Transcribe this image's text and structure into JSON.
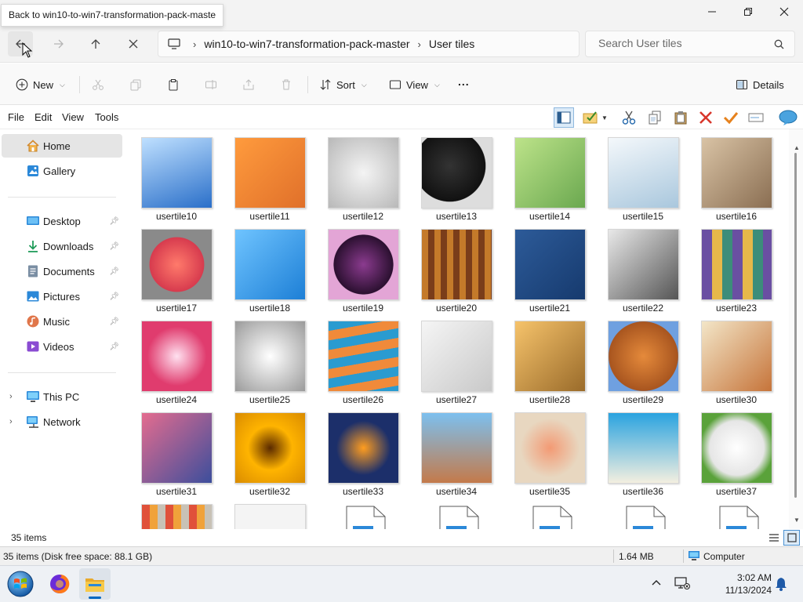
{
  "tooltip": "Back to win10-to-win7-transformation-pack-maste",
  "address": {
    "segments": [
      "win10-to-win7-transformation-pack-master",
      "User tiles"
    ],
    "search_placeholder": "Search User tiles"
  },
  "commands": {
    "new": "New",
    "sort": "Sort",
    "view": "View",
    "more": "...",
    "details": "Details"
  },
  "menu": [
    "File",
    "Edit",
    "View",
    "Tools"
  ],
  "sidebar": {
    "items": [
      {
        "label": "Home",
        "icon": "home-icon",
        "pinned": false,
        "expandable": false,
        "selected": true
      },
      {
        "label": "Gallery",
        "icon": "gallery-icon",
        "pinned": false,
        "expandable": false,
        "selected": false
      },
      {
        "label": "Desktop",
        "icon": "desktop-icon",
        "pinned": true,
        "expandable": false,
        "selected": false
      },
      {
        "label": "Downloads",
        "icon": "downloads-icon",
        "pinned": true,
        "expandable": false,
        "selected": false
      },
      {
        "label": "Documents",
        "icon": "documents-icon",
        "pinned": true,
        "expandable": false,
        "selected": false
      },
      {
        "label": "Pictures",
        "icon": "pictures-icon",
        "pinned": true,
        "expandable": false,
        "selected": false
      },
      {
        "label": "Music",
        "icon": "music-icon",
        "pinned": true,
        "expandable": false,
        "selected": false
      },
      {
        "label": "Videos",
        "icon": "videos-icon",
        "pinned": true,
        "expandable": false,
        "selected": false
      },
      {
        "label": "This PC",
        "icon": "this-pc-icon",
        "pinned": false,
        "expandable": true,
        "selected": false
      },
      {
        "label": "Network",
        "icon": "network-icon",
        "pinned": false,
        "expandable": true,
        "selected": false
      }
    ]
  },
  "files": [
    "usertile10",
    "usertile11",
    "usertile12",
    "usertile13",
    "usertile14",
    "usertile15",
    "usertile16",
    "usertile17",
    "usertile18",
    "usertile19",
    "usertile20",
    "usertile21",
    "usertile22",
    "usertile23",
    "usertile24",
    "usertile25",
    "usertile26",
    "usertile27",
    "usertile28",
    "usertile29",
    "usertile30",
    "usertile31",
    "usertile32",
    "usertile33",
    "usertile34",
    "usertile35",
    "usertile36",
    "usertile37"
  ],
  "partial_row_kinds": [
    "image",
    "image",
    "file",
    "file",
    "file",
    "file",
    "file"
  ],
  "status": {
    "item_count": "35 items",
    "disk_info": "35 items (Disk free space: 88.1 GB)",
    "size": "1.64 MB",
    "location": "Computer"
  },
  "taskbar": {
    "time": "3:02 AM",
    "date": "11/13/2024"
  },
  "colors": {
    "accent": "#0067c0",
    "delete_red": "#d8362b",
    "check_orange": "#e6821e"
  }
}
